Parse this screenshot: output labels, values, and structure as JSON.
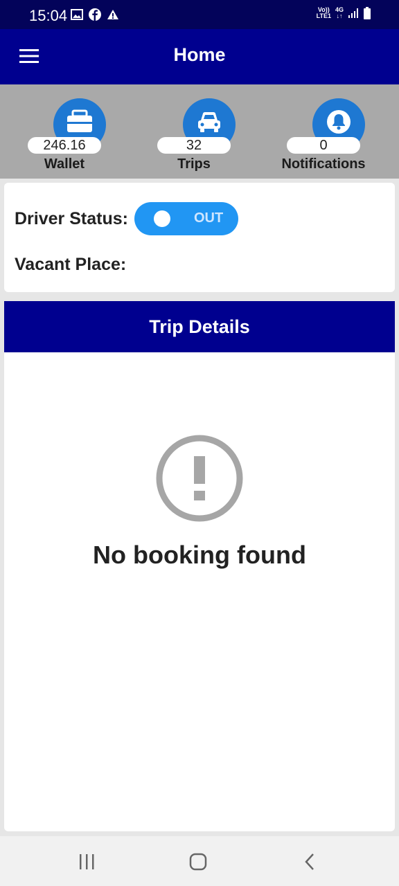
{
  "status_bar": {
    "time": "15:04",
    "left_icons": [
      "gallery-icon",
      "facebook-icon",
      "warning-icon"
    ],
    "volte_top": "Vo))",
    "volte_bottom": "LTE1",
    "network_top": "4G",
    "network_bottom": "↓↑"
  },
  "app_bar": {
    "title": "Home",
    "menu_icon": "hamburger-menu-icon"
  },
  "stats": [
    {
      "icon": "briefcase-icon",
      "value": "246.16",
      "label": "Wallet"
    },
    {
      "icon": "car-icon",
      "value": "32",
      "label": "Trips"
    },
    {
      "icon": "bell-icon",
      "value": "0",
      "label": "Notifications"
    }
  ],
  "driver": {
    "status_label": "Driver Status:",
    "toggle_text": "OUT",
    "vacant_label": "Vacant Place:"
  },
  "trip": {
    "header": "Trip Details",
    "empty_icon": "alert-circle-icon",
    "empty_text": "No booking found"
  },
  "nav": {
    "recents_icon": "recents-icon",
    "home_icon": "home-icon",
    "back_icon": "back-icon"
  },
  "colors": {
    "app_bar": "#00008f",
    "status_bar": "#03035a",
    "accent": "#1e78d2",
    "toggle": "#2196f3",
    "stats_bg": "#a9a9a9"
  }
}
